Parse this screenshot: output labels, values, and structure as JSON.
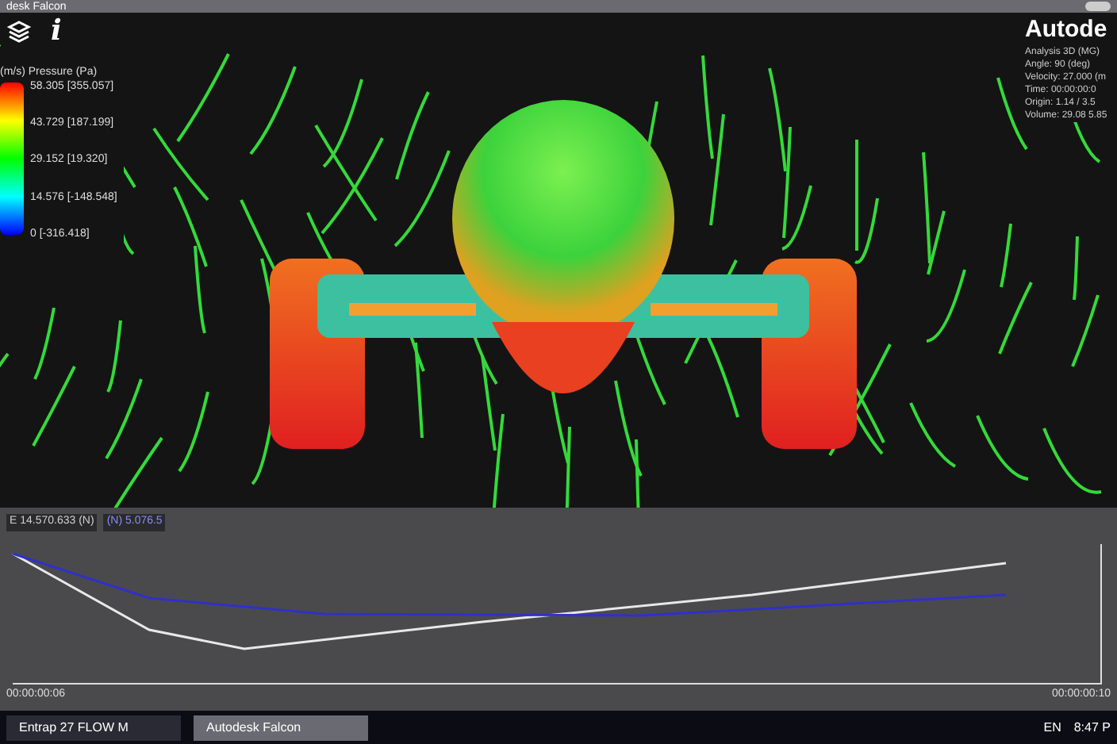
{
  "window": {
    "title": "desk Falcon"
  },
  "toolbar": {
    "info": "i"
  },
  "legend": {
    "title": "(m/s) Pressure (Pa)",
    "values": [
      "58.305 [355.057]",
      "43.729 [187.199]",
      "29.152 [19.320]",
      "14.576 [-148.548]",
      "0 [-316.418]"
    ]
  },
  "info_panel": {
    "logo": "Autode",
    "lines": [
      "Analysis 3D (MG)",
      "Angle: 90 (deg)",
      "Velocity: 27.000 (m",
      "Time: 00:00:00:0",
      "Origin: 1.14 / 3.5",
      "Volume: 29.08 5.85"
    ]
  },
  "graph": {
    "legend": [
      {
        "text": "E 14.570.633 (N)"
      },
      {
        "text": "(N) 5.076.5"
      }
    ],
    "x_start": "00:00:00:06",
    "x_end": "00:00:00:10"
  },
  "taskbar": {
    "items": [
      {
        "label": "Entrap 27 FLOW M",
        "selected": false
      },
      {
        "label": "Autodesk Falcon",
        "selected": true
      }
    ],
    "language": "EN",
    "clock": "8:47 P"
  }
}
